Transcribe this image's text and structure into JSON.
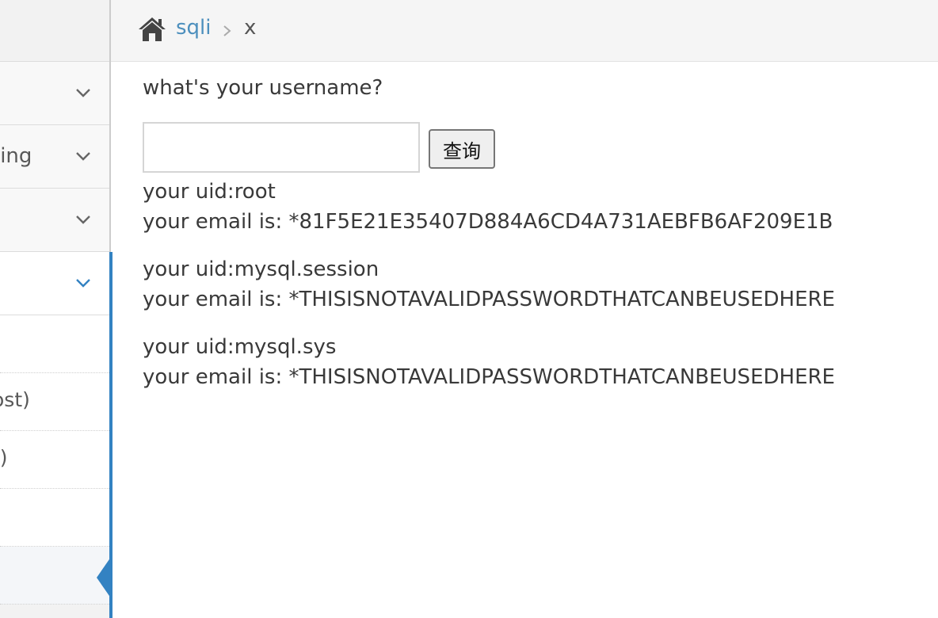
{
  "sidebar": {
    "items": [
      {
        "label": ""
      },
      {
        "label": "ting"
      },
      {
        "label": ""
      },
      {
        "label": ""
      }
    ],
    "sub_items": [
      {
        "label": ""
      },
      {
        "label": "ost)"
      },
      {
        "label": "t)"
      },
      {
        "label": ""
      },
      {
        "label": ""
      }
    ],
    "accent_color": "#3382c2"
  },
  "breadcrumb": {
    "home_icon": "home-icon",
    "link": "sqli",
    "current": "x"
  },
  "form": {
    "question": "what's your username?",
    "input_value": "",
    "input_placeholder": "",
    "button_label": "查询"
  },
  "results": [
    {
      "uid": "your uid:root",
      "email": "your email is: *81F5E21E35407D884A6CD4A731AEBFB6AF209E1B"
    },
    {
      "uid": "your uid:mysql.session",
      "email": "your email is: *THISISNOTAVALIDPASSWORDTHATCANBEUSEDHERE"
    },
    {
      "uid": "your uid:mysql.sys",
      "email": "your email is: *THISISNOTAVALIDPASSWORDTHATCANBEUSEDHERE"
    }
  ]
}
